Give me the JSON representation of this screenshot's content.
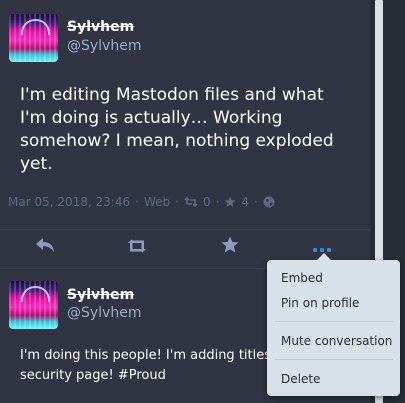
{
  "status1": {
    "display_name": "Sylvhem",
    "acct": "@Sylvhem",
    "content": "I'm editing Mastodon files and what I'm doing is actually… Working somehow? I mean, nothing exploded yet.",
    "timestamp": "Mar 05, 2018, 23:46",
    "separator": "·",
    "application": "Web",
    "boost_count": "0",
    "fav_count": "4",
    "visibility_icon": "globe-icon"
  },
  "actions": {
    "reply_icon": "reply-icon",
    "boost_icon": "retweet-icon",
    "favourite_icon": "star-icon",
    "more_icon": "ellipsis-icon"
  },
  "status2": {
    "display_name": "Sylvhem",
    "acct": "@Sylvhem",
    "content": "I'm doing this people! I'm adding titles\nsecurity page! #Proud"
  },
  "menu": {
    "embed": "Embed",
    "pin": "Pin on profile",
    "mute": "Mute conversation",
    "delete": "Delete"
  },
  "colors": {
    "background": "#313543",
    "accent": "#2b90d9",
    "muted": "#606984",
    "text": "#ffffff",
    "menu_bg": "#d9e1e8"
  }
}
